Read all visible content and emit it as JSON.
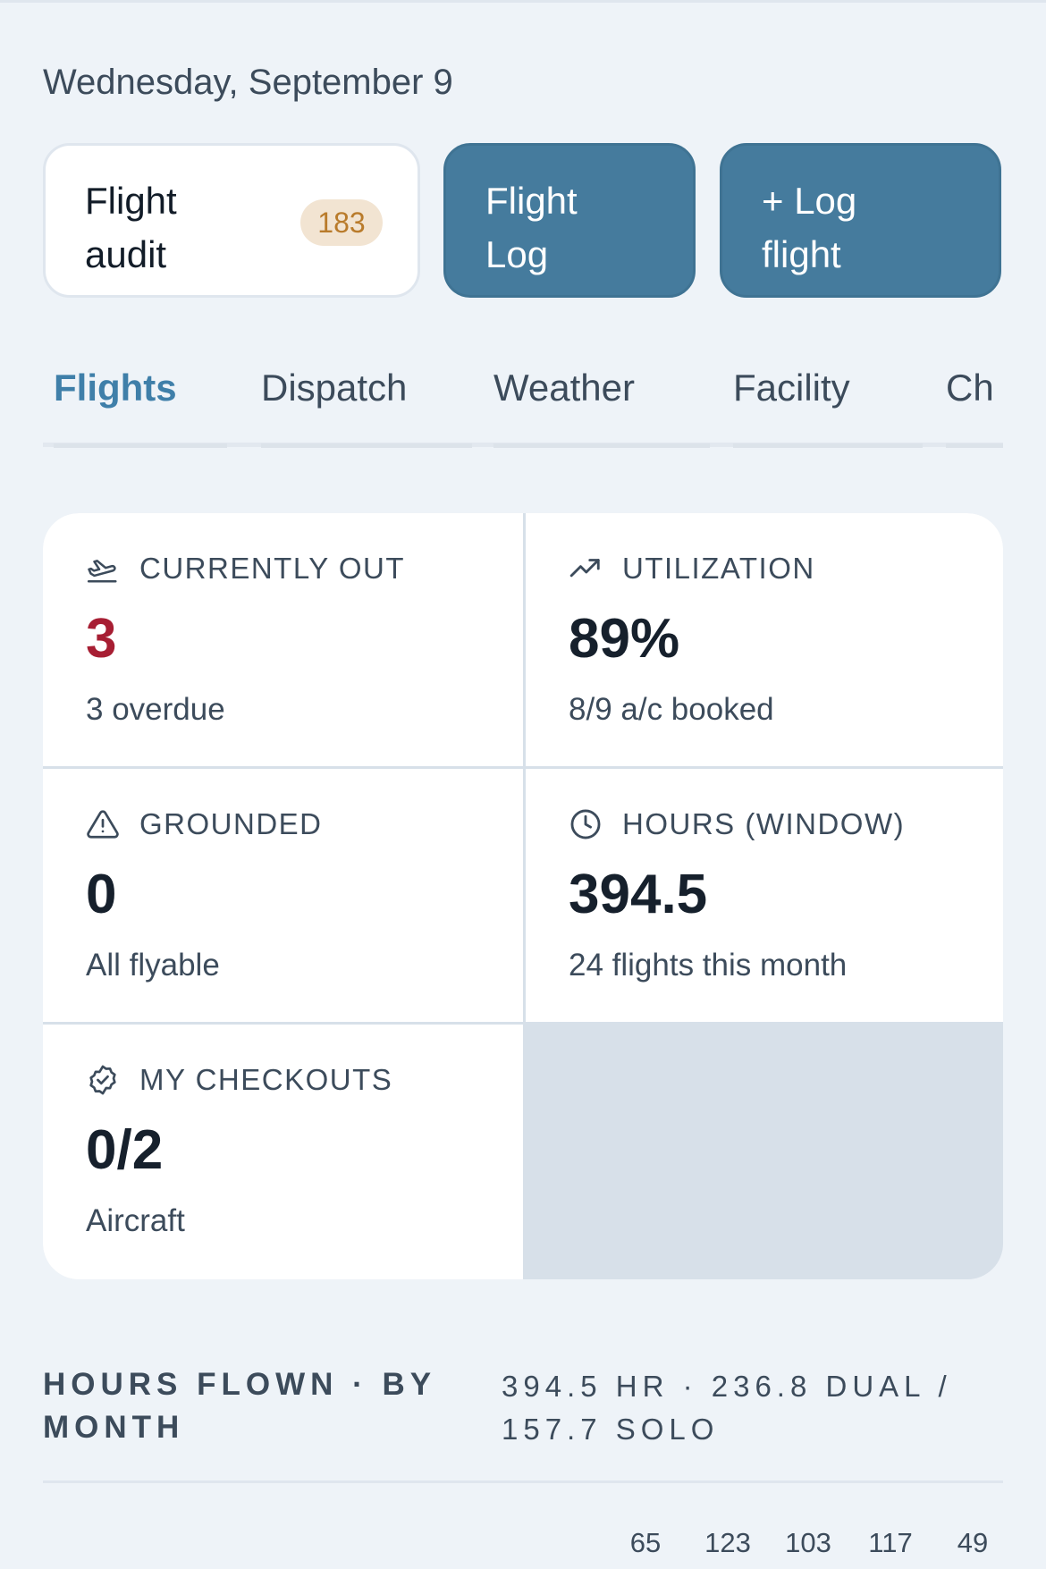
{
  "header": {
    "date": "Wednesday, September 9"
  },
  "actions": {
    "audit": {
      "label": "Flight audit",
      "badge": "183"
    },
    "log": {
      "label": "Flight Log"
    },
    "new_log": {
      "label": "+ Log flight"
    }
  },
  "tabs": [
    {
      "label": "Flights",
      "active": true
    },
    {
      "label": "Dispatch",
      "active": false
    },
    {
      "label": "Weather",
      "active": false
    },
    {
      "label": "Facility",
      "active": false
    },
    {
      "label": "Ch",
      "active": false
    }
  ],
  "stats": {
    "currently_out": {
      "label": "CURRENTLY OUT",
      "value": "3",
      "sub": "3 overdue",
      "icon": "plane-departure-icon"
    },
    "utilization": {
      "label": "UTILIZATION",
      "value": "89%",
      "sub": "8/9 a/c booked",
      "icon": "trending-up-icon"
    },
    "grounded": {
      "label": "GROUNDED",
      "value": "0",
      "sub": "All flyable",
      "icon": "warning-triangle-icon"
    },
    "hours": {
      "label": "HOURS (WINDOW)",
      "value": "394.5",
      "sub": "24 flights this month",
      "icon": "clock-icon"
    },
    "checkouts": {
      "label": "MY CHECKOUTS",
      "value": "0/2",
      "sub": "Aircraft",
      "icon": "badge-check-icon"
    }
  },
  "hours_section": {
    "title": "HOURS FLOWN · BY MONTH",
    "summary": "394.5 HR · 236.8 DUAL / 157.7 SOLO",
    "month_values": [
      "65",
      "123",
      "103",
      "117",
      "49"
    ]
  },
  "colors": {
    "accent": "#457b9d",
    "alert": "#a71e33",
    "badge_bg": "#f2e4d2",
    "badge_text": "#b97b2b",
    "background": "#eef3f8"
  }
}
